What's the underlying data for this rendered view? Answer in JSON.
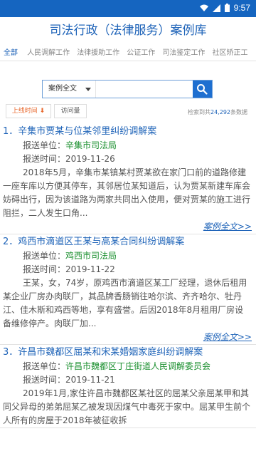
{
  "statusbar": {
    "time": "9:57"
  },
  "header": {
    "title": "司法行政（法律服务）案例库"
  },
  "tabs": [
    {
      "label": "全部",
      "active": true
    },
    {
      "label": "人民调解工作",
      "active": false
    },
    {
      "label": "法律援助工作",
      "active": false
    },
    {
      "label": "公证工作",
      "active": false
    },
    {
      "label": "司法鉴定工作",
      "active": false
    },
    {
      "label": "社区矫正工",
      "active": false
    }
  ],
  "search": {
    "type_label": "案例全文",
    "placeholder": ""
  },
  "sort": {
    "time_label": "上线时间",
    "views_label": "访问量"
  },
  "total": {
    "prefix": "检索到共",
    "count": "24,292",
    "suffix": "条数据"
  },
  "cases": [
    {
      "title": "1．辛集市贾某与位某邻里纠纷调解案",
      "unit_label": "报送单位：",
      "unit": "辛集市司法局",
      "time_label": "报送时间：",
      "time": "2019-11-26",
      "summary": "2018年5月，辛集市某镇某村贾某欲在家门口前的道路修建一座车库以方便其停车，其邻居位某知道后，认为贾某新建车库会妨碍出行，因为该道路为两家共同出入使用，便对贾某的施工进行阻拦，二人发生口角...",
      "more": "案例全文>>"
    },
    {
      "title": "2．鸡西市滴道区王某与高某合同纠纷调解案",
      "unit_label": "报送单位：",
      "unit": "鸡西市司法局",
      "time_label": "报送时间：",
      "time": "2019-11-22",
      "summary": "王某，女，74岁，原鸡西市滴道区某工厂经理，退休后租用某企业厂房办肉联厂，其品牌香肠销往哈尔滨、齐齐哈尔、牡丹江、佳木斯和鸡西等地，享有盛誉。后因2018年8月租用厂房设备维修停产。肉联厂加...",
      "more": "案例全文>>"
    },
    {
      "title": "3．许昌市魏都区屈某和宋某婚姻家庭纠纷调解案",
      "unit_label": "报送单位：",
      "unit": "许昌市魏都区丁庄街道人民调解委员会",
      "time_label": "报送时间：",
      "time": "2019-11-21",
      "summary": "2019年1月,家住许昌市魏都区某社区的屈某父亲屈某甲和其同父异母的弟弟屈某乙被发现因煤气中毒死于家中。屈某甲生前个人所有的房屋于2018年被征收拆",
      "more": ""
    }
  ]
}
